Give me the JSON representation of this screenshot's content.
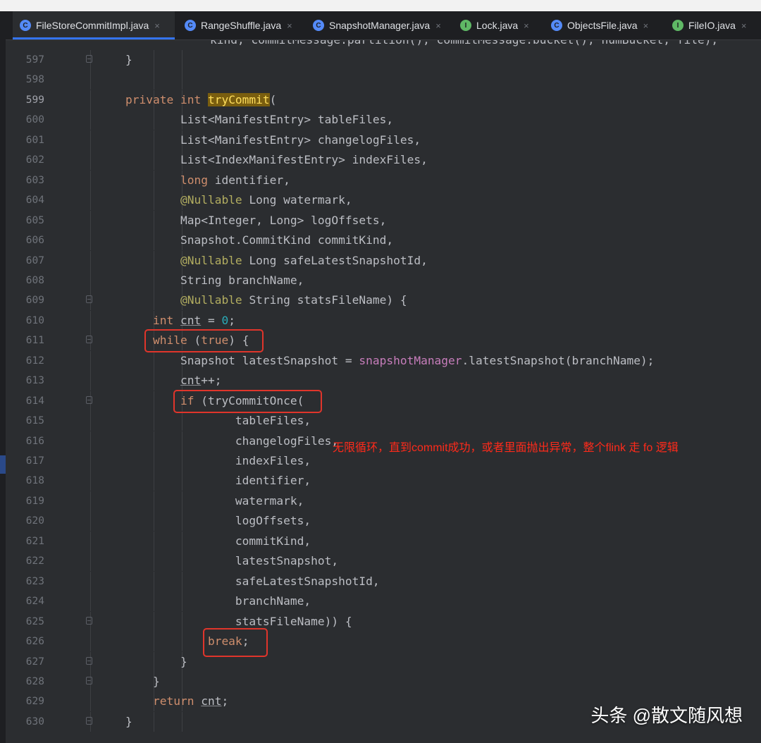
{
  "breadcrumb": "",
  "tabs": [
    {
      "label": "FileStoreCommitImpl.java",
      "icon": "class-icon",
      "icon_glyph": "C",
      "active": true
    },
    {
      "label": "RangeShuffle.java",
      "icon": "class-icon",
      "icon_glyph": "C",
      "active": false
    },
    {
      "label": "SnapshotManager.java",
      "icon": "class-icon",
      "icon_glyph": "C",
      "active": false
    },
    {
      "label": "Lock.java",
      "icon": "interface-icon",
      "icon_glyph": "I",
      "active": false
    },
    {
      "label": "ObjectsFile.java",
      "icon": "class-icon",
      "icon_glyph": "C",
      "active": false
    },
    {
      "label": "FileIO.java",
      "icon": "interface-icon",
      "icon_glyph": "I",
      "active": false
    }
  ],
  "tab_close_glyph": "×",
  "editor": {
    "partial_top_line": "kind, commitMessage.partition(), commitMessage.bucket(), numBucket, file);",
    "current_line": 599,
    "lines": [
      {
        "num": 597,
        "tokens": [
          [
            "p",
            "}"
          ]
        ]
      },
      {
        "num": 598,
        "tokens": []
      },
      {
        "num": 599,
        "tokens": [
          [
            "kw",
            "private "
          ],
          [
            "kw",
            "int "
          ],
          [
            "mhl",
            "tryCommit"
          ],
          [
            "p",
            "("
          ]
        ]
      },
      {
        "num": 600,
        "tokens": [
          [
            "p",
            "        List<ManifestEntry> tableFiles,"
          ]
        ]
      },
      {
        "num": 601,
        "tokens": [
          [
            "p",
            "        List<ManifestEntry> changelogFiles,"
          ]
        ]
      },
      {
        "num": 602,
        "tokens": [
          [
            "p",
            "        List<IndexManifestEntry> indexFiles,"
          ]
        ]
      },
      {
        "num": 603,
        "tokens": [
          [
            "kw",
            "        long "
          ],
          [
            "p",
            "identifier,"
          ]
        ]
      },
      {
        "num": 604,
        "tokens": [
          [
            "ann",
            "        @Nullable "
          ],
          [
            "p",
            "Long watermark,"
          ]
        ]
      },
      {
        "num": 605,
        "tokens": [
          [
            "p",
            "        Map<Integer, Long> logOffsets,"
          ]
        ]
      },
      {
        "num": 606,
        "tokens": [
          [
            "p",
            "        Snapshot.CommitKind commitKind,"
          ]
        ]
      },
      {
        "num": 607,
        "tokens": [
          [
            "ann",
            "        @Nullable "
          ],
          [
            "p",
            "Long safeLatestSnapshotId,"
          ]
        ]
      },
      {
        "num": 608,
        "tokens": [
          [
            "p",
            "        String branchName,"
          ]
        ]
      },
      {
        "num": 609,
        "tokens": [
          [
            "ann",
            "        @Nullable "
          ],
          [
            "p",
            "String statsFileName) {"
          ]
        ]
      },
      {
        "num": 610,
        "tokens": [
          [
            "kw",
            "    int "
          ],
          [
            "ul",
            "cnt"
          ],
          [
            "p",
            " = "
          ],
          [
            "num",
            "0"
          ],
          [
            "p",
            ";"
          ]
        ]
      },
      {
        "num": 611,
        "tokens": [
          [
            "kw",
            "    while "
          ],
          [
            "p",
            "("
          ],
          [
            "kw",
            "true"
          ],
          [
            "p",
            ") {"
          ]
        ]
      },
      {
        "num": 612,
        "tokens": [
          [
            "p",
            "        Snapshot latestSnapshot = "
          ],
          [
            "fld",
            "snapshotManager"
          ],
          [
            "p",
            ".latestSnapshot(branchName);"
          ]
        ]
      },
      {
        "num": 613,
        "tokens": [
          [
            "p",
            "        "
          ],
          [
            "ul",
            "cnt"
          ],
          [
            "p",
            "++;"
          ]
        ]
      },
      {
        "num": 614,
        "tokens": [
          [
            "kw",
            "        if "
          ],
          [
            "p",
            "(tryCommitOnce("
          ]
        ]
      },
      {
        "num": 615,
        "tokens": [
          [
            "p",
            "                tableFiles,"
          ]
        ]
      },
      {
        "num": 616,
        "tokens": [
          [
            "p",
            "                changelogFiles,"
          ]
        ]
      },
      {
        "num": 617,
        "tokens": [
          [
            "p",
            "                indexFiles,"
          ]
        ]
      },
      {
        "num": 618,
        "tokens": [
          [
            "p",
            "                identifier,"
          ]
        ]
      },
      {
        "num": 619,
        "tokens": [
          [
            "p",
            "                watermark,"
          ]
        ]
      },
      {
        "num": 620,
        "tokens": [
          [
            "p",
            "                logOffsets,"
          ]
        ]
      },
      {
        "num": 621,
        "tokens": [
          [
            "p",
            "                commitKind,"
          ]
        ]
      },
      {
        "num": 622,
        "tokens": [
          [
            "p",
            "                latestSnapshot,"
          ]
        ]
      },
      {
        "num": 623,
        "tokens": [
          [
            "p",
            "                safeLatestSnapshotId,"
          ]
        ]
      },
      {
        "num": 624,
        "tokens": [
          [
            "p",
            "                branchName,"
          ]
        ]
      },
      {
        "num": 625,
        "tokens": [
          [
            "p",
            "                statsFileName)) {"
          ]
        ]
      },
      {
        "num": 626,
        "tokens": [
          [
            "kw",
            "            break"
          ],
          [
            "p",
            ";"
          ]
        ]
      },
      {
        "num": 627,
        "tokens": [
          [
            "p",
            "        }"
          ]
        ]
      },
      {
        "num": 628,
        "tokens": [
          [
            "p",
            "    }"
          ]
        ]
      },
      {
        "num": 629,
        "tokens": [
          [
            "kw",
            "    return "
          ],
          [
            "ul",
            "cnt"
          ],
          [
            "p",
            ";"
          ]
        ]
      },
      {
        "num": 630,
        "tokens": [
          [
            "p",
            "}"
          ]
        ]
      }
    ],
    "fold_markers": [
      597,
      609,
      611,
      614,
      625,
      627,
      628,
      630
    ]
  },
  "annotation_note": "无限循环，直到commit成功，或者里面抛出异常，整个flink 走 fo 逻辑",
  "watermark": "头条 @散文随风想",
  "colors": {
    "editor_bg": "#2b2d30",
    "keyword": "#cf8e6d",
    "annotation": "#b3ae60",
    "number": "#2aacb8",
    "field": "#c77dbb",
    "highlight_box": "#e0352b",
    "note_text": "#ff2a1a",
    "active_tab_underline": "#3574f0"
  }
}
